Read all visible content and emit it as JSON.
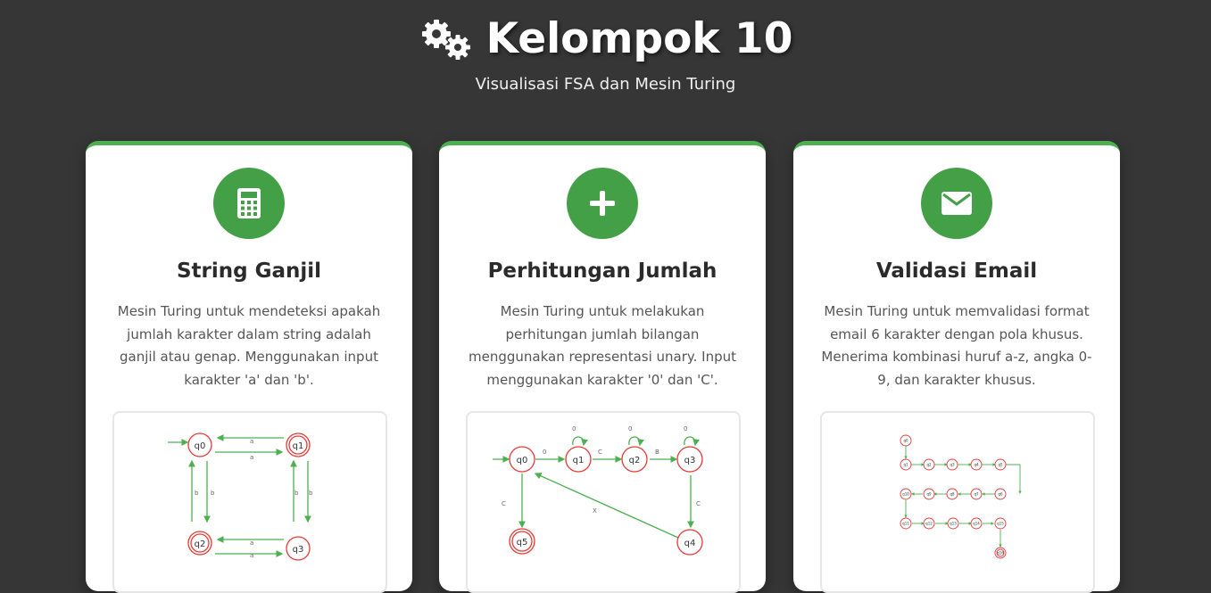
{
  "header": {
    "title": "Kelompok 10",
    "subtitle": "Visualisasi FSA dan Mesin Turing",
    "icon": "gears-icon"
  },
  "cards": [
    {
      "icon": "calculator-icon",
      "title": "String Ganjil",
      "description": "Mesin Turing untuk mendeteksi apakah jumlah karakter dalam string adalah ganjil atau genap. Menggunakan input karakter 'a' dan 'b'.",
      "diagram": {
        "states": [
          "q0",
          "q1",
          "q2",
          "q3"
        ],
        "edge_labels": [
          "a",
          "a",
          "b",
          "b",
          "b",
          "b",
          "a",
          "a"
        ]
      }
    },
    {
      "icon": "plus-icon",
      "title": "Perhitungan Jumlah",
      "description": "Mesin Turing untuk melakukan perhitungan jumlah bilangan menggunakan representasi unary. Input menggunakan karakter '0' dan 'C'.",
      "diagram": {
        "states": [
          "q0",
          "q1",
          "q2",
          "q3",
          "q4",
          "q5"
        ],
        "edge_labels": [
          "0",
          "C",
          "B",
          "0",
          "0",
          "0",
          "C",
          "C",
          "X"
        ]
      }
    },
    {
      "icon": "envelope-icon",
      "title": "Validasi Email",
      "description": "Mesin Turing untuk memvalidasi format email 6 karakter dengan pola khusus. Menerima kombinasi huruf a-z, angka 0-9, dan karakter khusus.",
      "diagram": {
        "states": [
          "q0",
          "q1",
          "q2",
          "q3",
          "q4",
          "q5",
          "q6",
          "q7",
          "q8",
          "q9",
          "q10",
          "q11",
          "q12",
          "q13",
          "q14",
          "q15",
          "q16"
        ]
      }
    }
  ],
  "colors": {
    "background": "#363636",
    "accent": "#43a047",
    "state_stroke": "#e53935",
    "edge": "#4caf50"
  }
}
